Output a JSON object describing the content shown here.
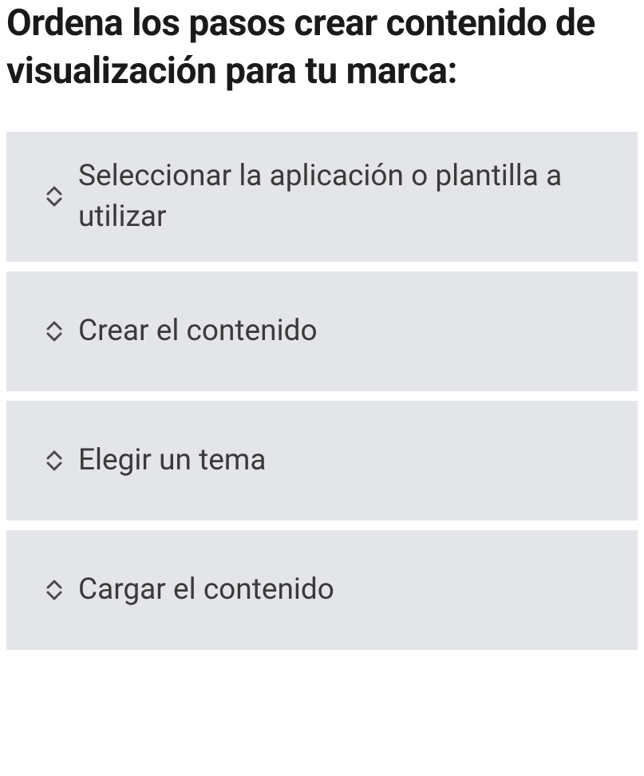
{
  "question": {
    "title": "Ordena los pasos crear contenido de visualización para tu marca:"
  },
  "items": [
    {
      "text": "Seleccionar la aplicación o plantilla a utilizar"
    },
    {
      "text": "Crear el contenido"
    },
    {
      "text": "Elegir un tema"
    },
    {
      "text": "Cargar el contenido"
    }
  ]
}
